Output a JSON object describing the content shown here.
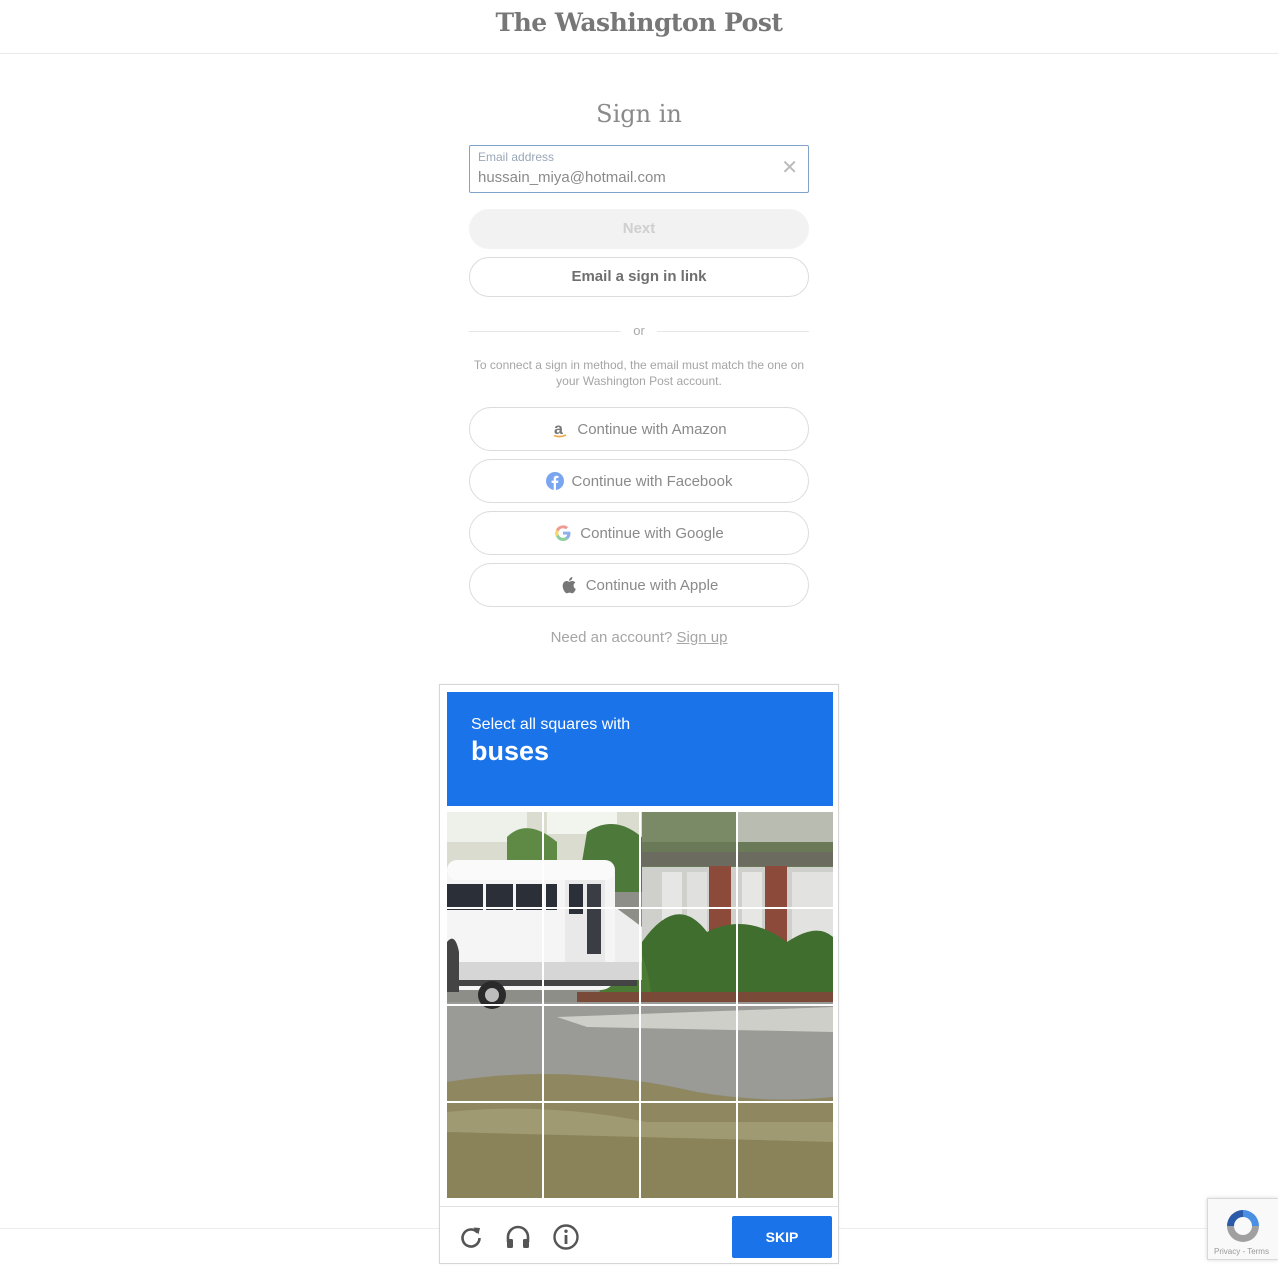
{
  "header": {
    "logo": "The Washington Post"
  },
  "signin": {
    "title": "Sign in",
    "email_label": "Email address",
    "email_value": "hussain_miya@hotmail.com",
    "clear_glyph": "✕",
    "next_label": "Next",
    "email_link_label": "Email a sign in link",
    "or_label": "or",
    "note": "To connect a sign in method, the email must match the one on your Washington Post account.",
    "social": [
      {
        "label": "Continue with Amazon",
        "icon": "amazon-icon"
      },
      {
        "label": "Continue with Facebook",
        "icon": "facebook-icon"
      },
      {
        "label": "Continue with Google",
        "icon": "google-icon"
      },
      {
        "label": "Continue with Apple",
        "icon": "apple-icon"
      }
    ],
    "signup_prompt": "Need an account?",
    "signup_link": "Sign up"
  },
  "captcha": {
    "instruction": "Select all squares with",
    "target": "buses",
    "skip_label": "SKIP",
    "icons": [
      "reload-icon",
      "headphones-icon",
      "info-icon"
    ],
    "accent": "#1a73e8"
  },
  "recaptcha_badge": {
    "text": "Privacy - Terms"
  }
}
